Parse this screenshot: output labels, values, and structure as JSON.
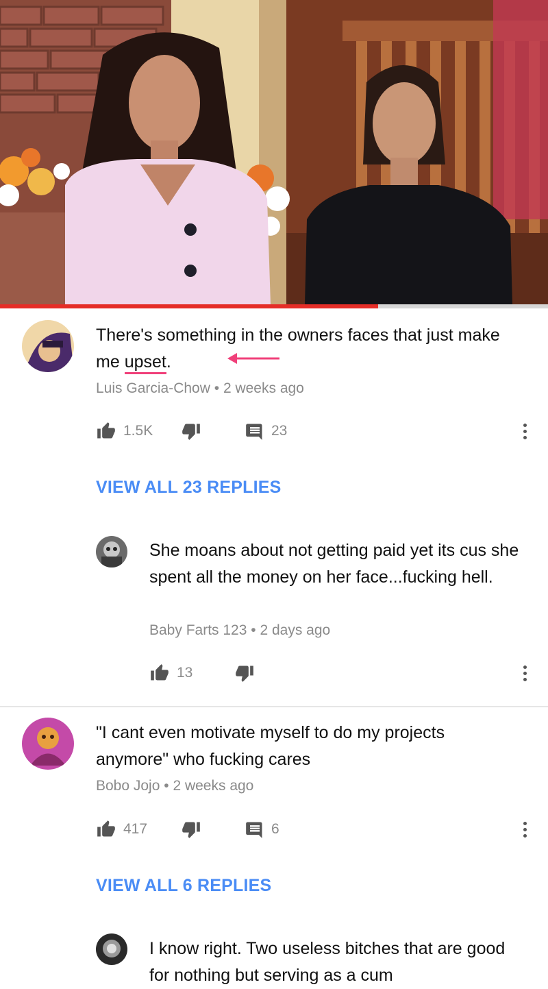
{
  "video": {
    "progress": 0.69
  },
  "comments": [
    {
      "text_before": "There's something in the owners faces that just make me ",
      "text_highlight": "upset",
      "text_after": ".",
      "author": "Luis Garcia-Chow",
      "time": "2 weeks ago",
      "likes": "1.5K",
      "replies_count": "23",
      "view_replies": "VIEW ALL 23 REPLIES"
    },
    {
      "text_before": "\"I cant even motivate myself to do my projects anymore\" who fucking cares",
      "author": "Bobo Jojo",
      "time": "2 weeks ago",
      "likes": "417",
      "replies_count": "6",
      "view_replies": "VIEW ALL 6 REPLIES"
    }
  ],
  "replies": [
    {
      "text": "She moans about not getting paid yet its cus she spent all the money on her face...fucking hell.",
      "author": "Baby Farts 123",
      "time": "2 days ago",
      "likes": "13"
    },
    {
      "text": "I know right. Two useless bitches that are good for nothing but serving as a cum"
    }
  ],
  "separator": "•",
  "icons": {
    "like": "thumbs-up-icon",
    "dislike": "thumbs-down-icon",
    "reply": "comment-icon",
    "more": "more-vertical-icon",
    "annotation": "arrow-left-icon"
  },
  "colors": {
    "link_blue": "#4a8cf5",
    "progress_red": "#e52d27",
    "annotation_pink": "#f0407a",
    "meta_gray": "#8a8a8a"
  }
}
